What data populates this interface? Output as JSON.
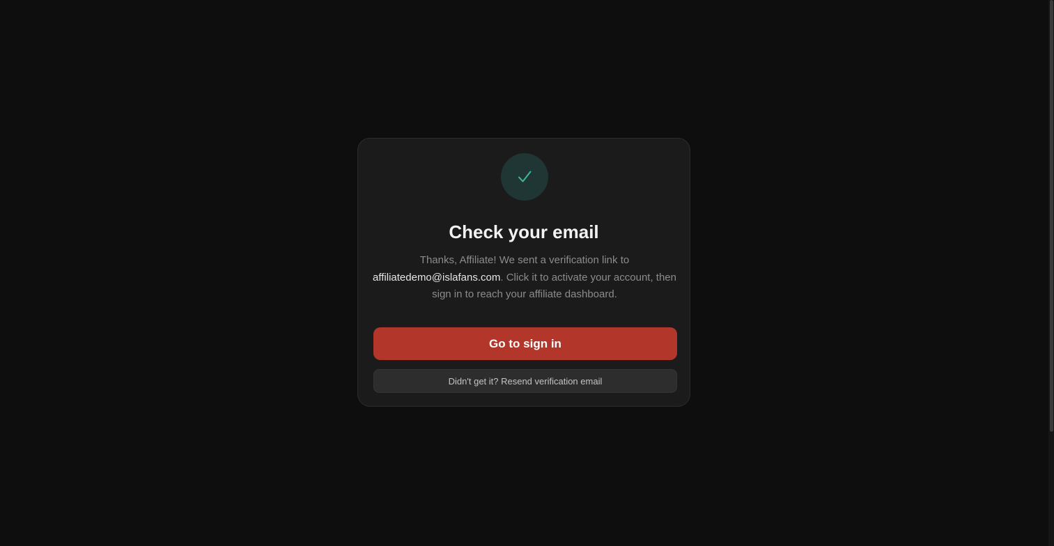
{
  "card": {
    "icon": "checkmark-icon",
    "icon_color": "#3fb8a0",
    "title": "Check your email",
    "message_prefix": "Thanks, Affiliate! We sent a verification link to ",
    "email": "affiliatedemo@islafans.com",
    "message_suffix": ". Click it to activate your account, then sign in to reach your affiliate dashboard.",
    "primary_button_label": "Go to sign in",
    "secondary_button_label": "Didn't get it? Resend verification email"
  },
  "colors": {
    "background": "#0e0e0e",
    "card": "#1b1b1b",
    "accent": "#b3362b",
    "success": "#3fb8a0"
  }
}
